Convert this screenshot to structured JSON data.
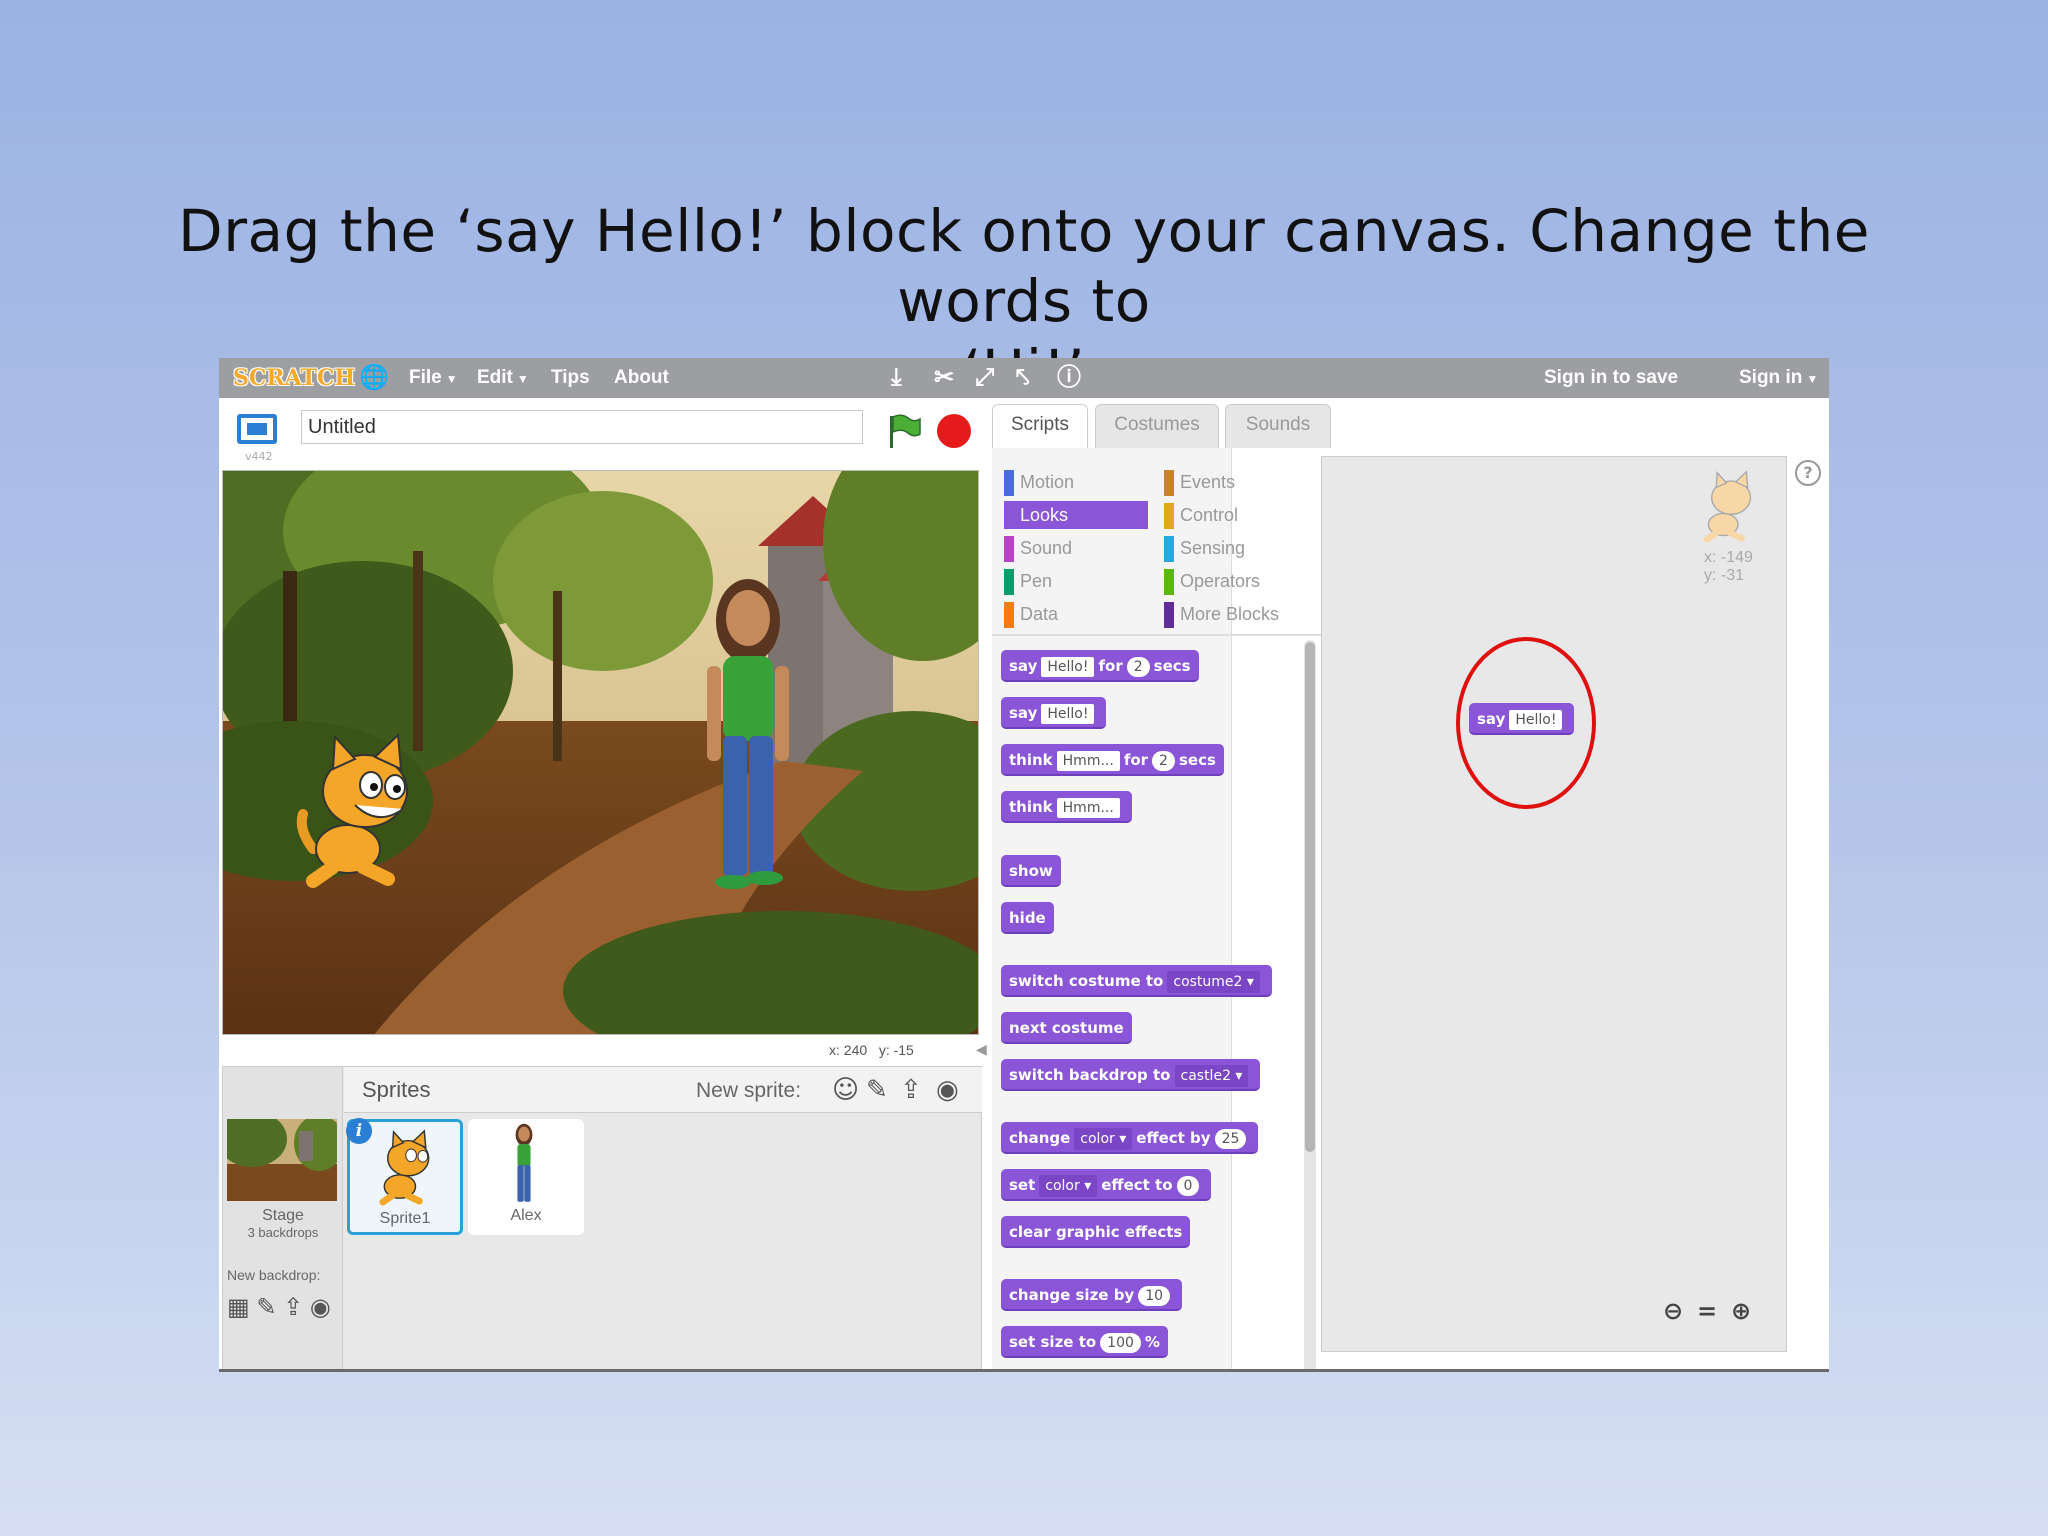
{
  "slide": {
    "title_line1": "Drag the ‘say Hello!’ block onto your canvas. Change the words to",
    "title_line2": "‘Hi!’"
  },
  "menubar": {
    "logo": "SCRATCH",
    "globe_icon": "globe-icon",
    "file": "File",
    "edit": "Edit",
    "tips": "Tips",
    "about": "About",
    "tools": [
      "duplicate-icon",
      "delete-icon",
      "grow-icon",
      "shrink-icon",
      "help-icon"
    ],
    "sign_in_to_save": "Sign in to save",
    "sign_in": "Sign in"
  },
  "project": {
    "title_value": "Untitled",
    "version": "v442"
  },
  "stage": {
    "mouse_x_label": "x:",
    "mouse_x": "240",
    "mouse_y_label": "y:",
    "mouse_y": "-15"
  },
  "sprites_pane": {
    "header": "Sprites",
    "new_sprite": "New sprite:",
    "stage_label": "Stage",
    "stage_backdrops": "3 backdrops",
    "new_backdrop": "New backdrop:",
    "sprites": [
      {
        "name": "Sprite1",
        "selected": true
      },
      {
        "name": "Alex",
        "selected": false
      }
    ]
  },
  "tabs": [
    "Scripts",
    "Costumes",
    "Sounds"
  ],
  "categories_left": [
    {
      "label": "Motion",
      "color": "#4a6cd4"
    },
    {
      "label": "Looks",
      "color": "#8a55d7"
    },
    {
      "label": "Sound",
      "color": "#bb42c3"
    },
    {
      "label": "Pen",
      "color": "#0e9a6c"
    },
    {
      "label": "Data",
      "color": "#ee7d16"
    }
  ],
  "categories_right": [
    {
      "label": "Events",
      "color": "#c88330"
    },
    {
      "label": "Control",
      "color": "#e1a91a"
    },
    {
      "label": "Sensing",
      "color": "#2ca5e2"
    },
    {
      "label": "Operators",
      "color": "#5cb712"
    },
    {
      "label": "More Blocks",
      "color": "#632d99"
    }
  ],
  "blocks": {
    "say_for": {
      "say": "say",
      "text": "Hello!",
      "for": "for",
      "num": "2",
      "secs": "secs"
    },
    "say": {
      "say": "say",
      "text": "Hello!"
    },
    "think_for": {
      "think": "think",
      "text": "Hmm...",
      "for": "for",
      "num": "2",
      "secs": "secs"
    },
    "think": {
      "think": "think",
      "text": "Hmm..."
    },
    "show": "show",
    "hide": "hide",
    "switch_costume": {
      "label": "switch costume to",
      "value": "costume2"
    },
    "next_costume": "next costume",
    "switch_backdrop": {
      "label": "switch backdrop to",
      "value": "castle2"
    },
    "change_effect": {
      "change": "change",
      "effect": "color",
      "by": "effect by",
      "num": "25"
    },
    "set_effect": {
      "set": "set",
      "effect": "color",
      "to": "effect to",
      "num": "0"
    },
    "clear_effects": "clear graphic effects",
    "change_size": {
      "label": "change size by",
      "num": "10"
    },
    "set_size": {
      "label": "set size to",
      "num": "100",
      "unit": "%"
    }
  },
  "script_area": {
    "sprite_x": "x: -149",
    "sprite_y": "y: -31",
    "placed_block": {
      "say": "say",
      "text": "Hello!"
    },
    "highlight_color": "#e01010",
    "zoom_out": "zoom-out-icon",
    "zoom_reset": "zoom-reset-icon",
    "zoom_in": "zoom-in-icon"
  }
}
